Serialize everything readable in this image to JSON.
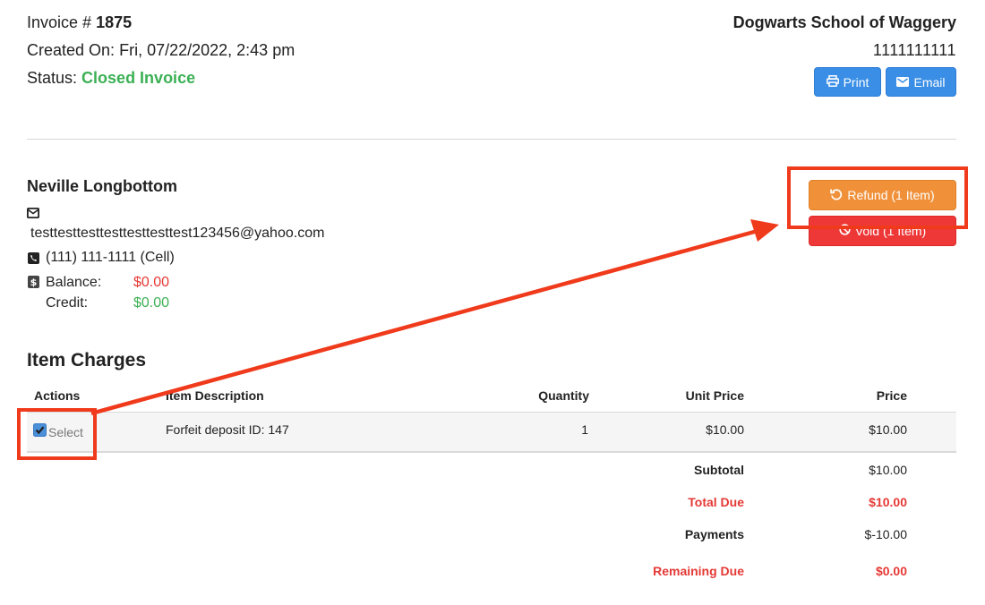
{
  "invoice": {
    "number_label": "Invoice #",
    "number": "1875",
    "created_label": "Created On:",
    "created_value": "Fri, 07/22/2022, 2:43 pm",
    "status_label": "Status:",
    "status_value": "Closed Invoice"
  },
  "org": {
    "name": "Dogwarts School of Waggery",
    "phone": "1111111111"
  },
  "header_buttons": {
    "print": "Print",
    "email": "Email"
  },
  "actions": {
    "refund": "Refund (1 Item)",
    "void": "Void (1 Item)"
  },
  "customer": {
    "name": "Neville Longbottom",
    "email": "testtesttesttesttesttesttest123456@yahoo.com",
    "phone": "(111) 111-1111 (Cell)",
    "balance_label": "Balance:",
    "balance_value": "$0.00",
    "credit_label": "Credit:",
    "credit_value": "$0.00"
  },
  "charges": {
    "title": "Item Charges",
    "columns": [
      "Actions",
      "Item Description",
      "Quantity",
      "Unit Price",
      "Price"
    ],
    "rows": [
      {
        "select_label": "Select",
        "selected": true,
        "description": "Forfeit deposit ID: 147",
        "quantity": "1",
        "unit_price": "$10.00",
        "price": "$10.00"
      }
    ],
    "totals": [
      {
        "label": "Subtotal",
        "value": "$10.00"
      },
      {
        "label": "Total Due",
        "value": "$10.00"
      },
      {
        "label": "Payments",
        "value": "$-10.00"
      },
      {
        "label": "Remaining Due",
        "value": "$0.00"
      }
    ]
  },
  "colors": {
    "accent_blue": "#3a8ee6",
    "refund_orange": "#f0913a",
    "void_red": "#ee3838",
    "status_green": "#3cb054",
    "annotation_red": "#f03a1c"
  },
  "icons": [
    "print-icon",
    "email-icon",
    "refund-icon",
    "void-icon",
    "envelope-icon",
    "phone-icon",
    "dollar-icon",
    "checkbox-checked-icon"
  ]
}
